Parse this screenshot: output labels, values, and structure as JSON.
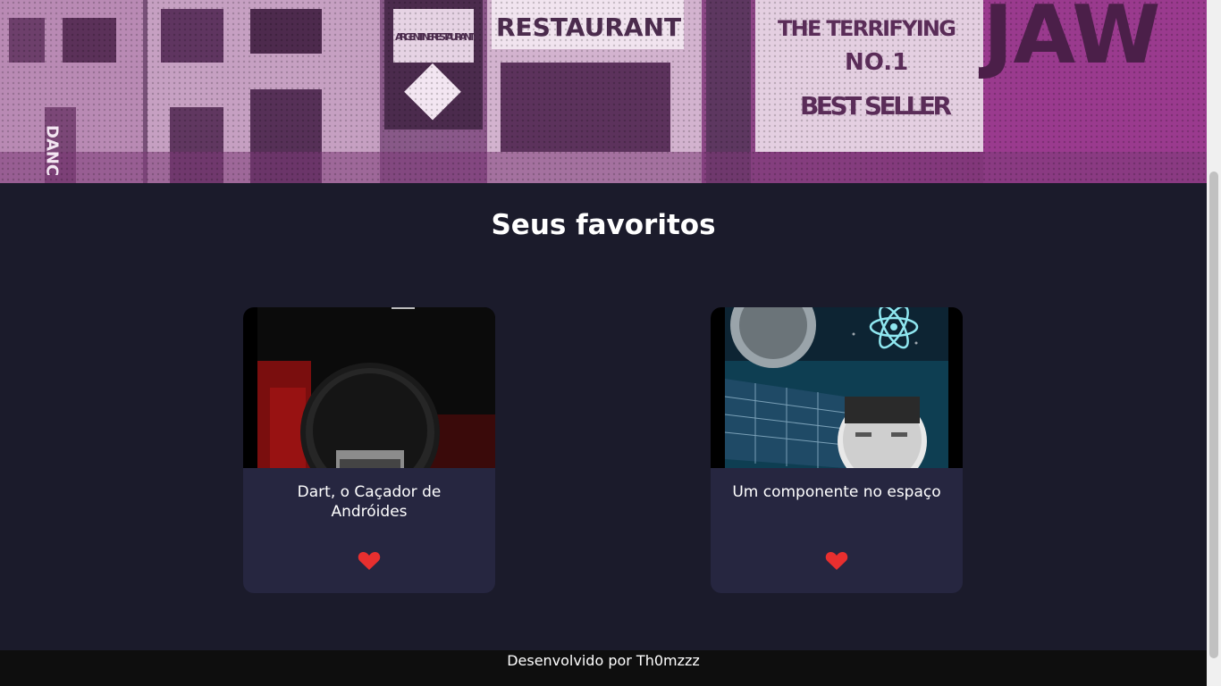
{
  "banner": {
    "signs": [
      "RESTAURANT",
      "ARGENTINE RESTAURANT",
      "THE TERRIFYING",
      "NO.1",
      "BEST SELLER",
      "DANC",
      "JAW"
    ]
  },
  "main": {
    "title": "Seus favoritos"
  },
  "cards": [
    {
      "title": "Dart, o Caçador de Andróides",
      "icon": "heart-icon",
      "favorited": true
    },
    {
      "title": "Um componente no espaço",
      "icon": "heart-icon",
      "favorited": true
    }
  ],
  "footer": {
    "text": "Desenvolvido por Th0mzzz"
  },
  "colors": {
    "background": "#1b1b2b",
    "card": "#262640",
    "heart": "#e82f2f",
    "footer": "#0e0e0e"
  }
}
